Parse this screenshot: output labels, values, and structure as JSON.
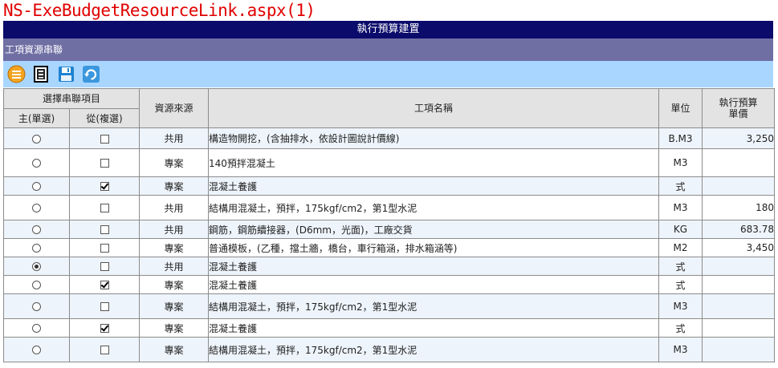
{
  "page_title": "NS-ExeBudgetResourceLink.aspx(1)",
  "header": {
    "title": "執行預算建置"
  },
  "section": {
    "title": "工項資源串聯"
  },
  "toolbar": {
    "buttons": [
      {
        "icon": "list-icon",
        "color": "#f0a020"
      },
      {
        "icon": "document-icon",
        "color": "#000000"
      },
      {
        "icon": "save-icon",
        "color": "#1a7cc8"
      },
      {
        "icon": "refresh-icon",
        "color": "#2b8fd6"
      }
    ]
  },
  "table": {
    "headers": {
      "select_group": "選擇串聯項目",
      "main": "主(單選)",
      "sub": "從(複選)",
      "source": "資源來源",
      "name": "工項名稱",
      "unit": "單位",
      "price_line1": "執行預算",
      "price_line2": "單價"
    },
    "rows": [
      {
        "main_selected": false,
        "sub_checked": false,
        "source": "共用",
        "name": "構造物開挖，(含抽排水，依設計圖說計價線)",
        "unit": "B.M3",
        "price": "3,250"
      },
      {
        "main_selected": false,
        "sub_checked": false,
        "source": "專案",
        "name": "140預拌混凝土",
        "unit": "M3",
        "price": ""
      },
      {
        "main_selected": false,
        "sub_checked": true,
        "source": "專案",
        "name": "混凝土養護",
        "unit": "式",
        "price": ""
      },
      {
        "main_selected": false,
        "sub_checked": false,
        "source": "共用",
        "name": "結構用混凝土，預拌，175kgf/cm2，第1型水泥",
        "unit": "M3",
        "price": "180"
      },
      {
        "main_selected": false,
        "sub_checked": false,
        "source": "共用",
        "name": "鋼筋，鋼筋續接器，(D6mm，光面)，工廠交貨",
        "unit": "KG",
        "price": "683.78"
      },
      {
        "main_selected": false,
        "sub_checked": false,
        "source": "專案",
        "name": "普通模板，(乙種，擋土牆，橋台，車行箱涵，排水箱涵等)",
        "unit": "M2",
        "price": "3,450"
      },
      {
        "main_selected": true,
        "sub_checked": false,
        "source": "共用",
        "name": "混凝土養護",
        "unit": "式",
        "price": ""
      },
      {
        "main_selected": false,
        "sub_checked": true,
        "source": "專案",
        "name": "混凝土養護",
        "unit": "式",
        "price": ""
      },
      {
        "main_selected": false,
        "sub_checked": false,
        "source": "專案",
        "name": "結構用混凝土，預拌，175kgf/cm2，第1型水泥",
        "unit": "M3",
        "price": ""
      },
      {
        "main_selected": false,
        "sub_checked": true,
        "source": "專案",
        "name": "混凝土養護",
        "unit": "式",
        "price": ""
      },
      {
        "main_selected": false,
        "sub_checked": false,
        "source": "專案",
        "name": "結構用混凝土，預拌，175kgf/cm2，第1型水泥",
        "unit": "M3",
        "price": ""
      }
    ]
  }
}
